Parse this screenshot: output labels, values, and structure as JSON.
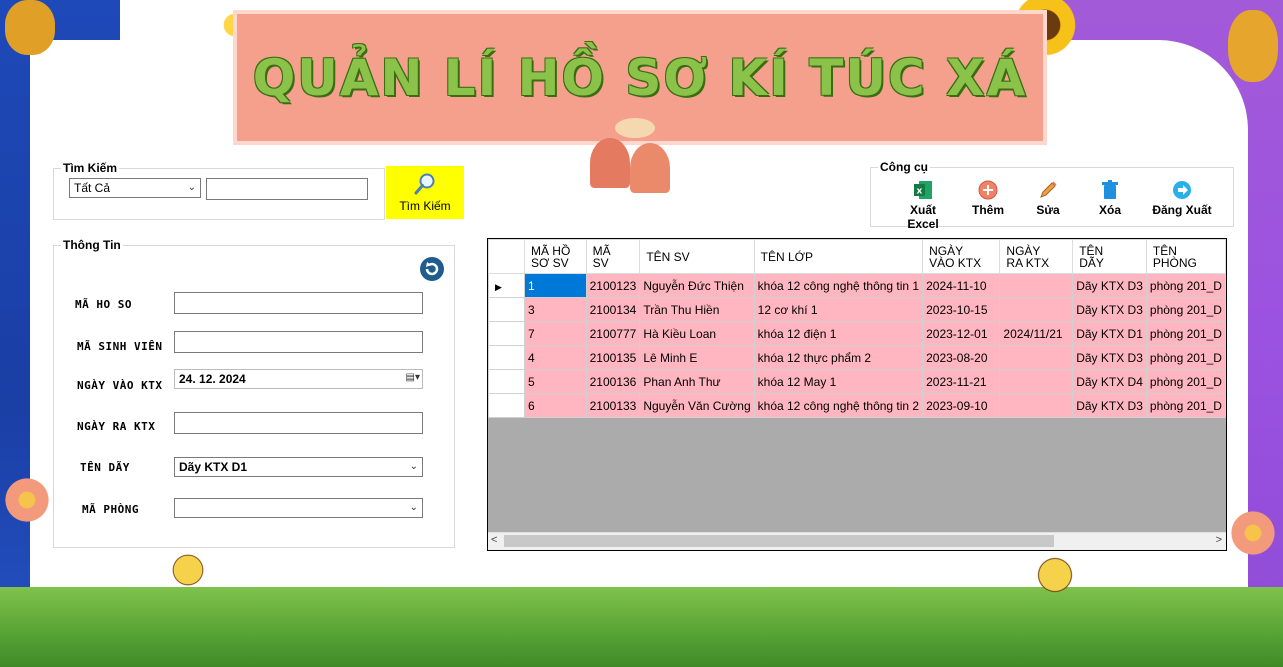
{
  "title": "QUẢN LÍ HỒ SƠ KÍ TÚC XÁ",
  "search": {
    "legend": "Tìm Kiếm",
    "filter_selected": "Tất Cả",
    "query_value": "",
    "button_label": "Tìm Kiếm"
  },
  "tools": {
    "legend": "Công cụ",
    "export_label": "Xuất Excel",
    "add_label": "Thêm",
    "edit_label": "Sửa",
    "delete_label": "Xóa",
    "logout_label": "Đăng Xuất"
  },
  "info": {
    "legend": "Thông Tin",
    "ma_ho_so_label": "MÃ HO SO",
    "ma_ho_so_value": "",
    "ma_sinh_vien_label": "MÃ SINH VIÊN",
    "ma_sinh_vien_value": "",
    "ngay_vao_label": "NGÀY VÀO KTX",
    "ngay_vao_value": "24. 12. 2024",
    "ngay_ra_label": "NGÀY RA KTX",
    "ngay_ra_value": "",
    "ten_day_label": "TÊN DÃY",
    "ten_day_value": "Dãy KTX D1",
    "ma_phong_label": "MÃ PHÒNG",
    "ma_phong_value": ""
  },
  "grid": {
    "columns": [
      "MÃ HỒ SƠ SV",
      "MÃ SV",
      "TÊN SV",
      "TÊN LỚP",
      "NGÀY VÀO KTX",
      "NGÀY RA KTX",
      "TÊN DÃY",
      "TÊN PHÒNG"
    ],
    "columns_display": [
      [
        "MÃ HỒ",
        "SƠ SV"
      ],
      [
        "MÃ",
        "SV"
      ],
      [
        "TÊN SV",
        ""
      ],
      [
        "TÊN LỚP",
        ""
      ],
      [
        "NGÀY",
        "VÀO KTX"
      ],
      [
        "NGÀY",
        "RA KTX"
      ],
      [
        "TÊN",
        "DÃY"
      ],
      [
        "TÊN",
        "PHÒNG"
      ]
    ],
    "rows": [
      [
        "1",
        "2100123",
        "Nguyễn Đức Thiện",
        "khóa 12 công nghệ thông tin 1",
        "2024-11-10",
        "",
        "Dãy KTX D3",
        "phòng 201_D"
      ],
      [
        "3",
        "2100134",
        "Trần Thu Hiền",
        "12 cơ khí 1",
        "2023-10-15",
        "",
        "Dãy KTX D3",
        "phòng 201_D"
      ],
      [
        "7",
        "2100777",
        "Hà Kiều Loan",
        "khóa 12 điện 1",
        "2023-12-01",
        "2024/11/21",
        "Dãy KTX D1",
        "phòng 201_D"
      ],
      [
        "4",
        "2100135",
        "Lê Minh E",
        "khóa 12 thực phẩm 2",
        "2023-08-20",
        "",
        "Dãy KTX D3",
        "phòng 201_D"
      ],
      [
        "5",
        "2100136",
        "Phan Anh Thư",
        "khóa 12 May 1",
        "2023-11-21",
        "",
        "Dãy KTX D4",
        "phòng 201_D"
      ],
      [
        "6",
        "2100133",
        "Nguyễn Văn Cường",
        "khóa 12 công nghệ thông tin 2",
        "2023-09-10",
        "",
        "Dãy KTX D3",
        "phòng 201_D"
      ]
    ],
    "selected_row": 0,
    "cell_color": "#ffb6c1",
    "selected_color": "#0078d7"
  },
  "icons": {
    "search": "magnifier-icon",
    "excel": "excel-icon",
    "add": "plus-circle-icon",
    "edit": "pencil-icon",
    "delete": "trash-icon",
    "logout": "arrow-right-icon",
    "refresh": "refresh-icon"
  }
}
